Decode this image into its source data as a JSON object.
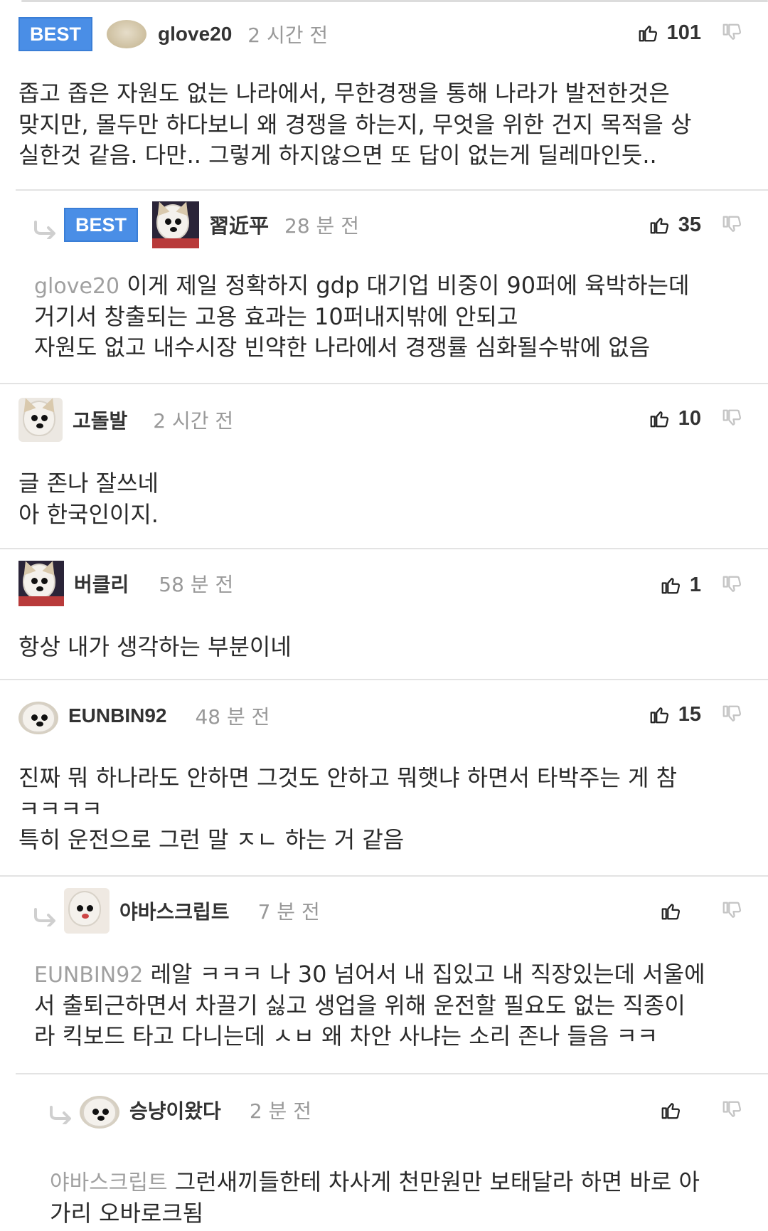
{
  "comments": [
    {
      "best": "BEST",
      "username": "glove20",
      "time": "2 시간 전",
      "likes": "101",
      "mention": "",
      "text": "좁고 좁은 자원도 없는 나라에서, 무한경쟁을 통해 나라가 발전한것은\n맞지만, 몰두만 하다보니 왜 경쟁을 하는지, 무엇을 위한 건지 목적을 상\n실한것 같음. 다만.. 그렇게 하지않으면 또 답이 없는게 딜레마인듯.."
    },
    {
      "best": "BEST",
      "username": "習近平",
      "time": "28 분 전",
      "likes": "35",
      "mention": "glove20",
      "text": "이게 제일 정확하지 gdp 대기업 비중이 90퍼에 육박하는데\n거기서 창출되는 고용 효과는 10퍼내지밖에 안되고\n자원도 없고 내수시장 빈약한 나라에서 경쟁률 심화될수밖에 없음"
    },
    {
      "username": "고돌발",
      "time": "2 시간 전",
      "likes": "10",
      "mention": "",
      "text": "글 존나 잘쓰네\n아 한국인이지."
    },
    {
      "username": "버클리",
      "time": "58 분 전",
      "likes": "1",
      "mention": "",
      "text": "항상 내가 생각하는 부분이네"
    },
    {
      "username": "EUNBIN92",
      "time": "48 분 전",
      "likes": "15",
      "mention": "",
      "text": "진짜 뭐 하나라도 안하면 그것도 안하고 뭐햇냐 하면서 타박주는 게 참\nㅋㅋㅋㅋ\n특히 운전으로 그런 말 ㅈㄴ 하는 거 같음"
    },
    {
      "username": "야바스크립트",
      "time": "7 분 전",
      "likes": "",
      "mention": "EUNBIN92",
      "text": "레알 ㅋㅋㅋ 나 30 넘어서 내 집있고 내 직장있는데 서울에\n서 출퇴근하면서 차끌기 싫고 생업을 위해 운전할 필요도 없는 직종이\n라 킥보드 타고 다니는데 ㅅㅂ 왜 차안 사냐는 소리 존나 들음 ㅋㅋ"
    },
    {
      "username": "승냥이왔다",
      "time": "2 분 전",
      "likes": "",
      "mention": "야바스크립트",
      "text": "그런새끼들한테 차사게 천만원만 보태달라 하면 바로 아\n가리 오바로크됨"
    }
  ],
  "icons": {
    "like": "thumbs-up-icon",
    "dislike": "thumbs-down-icon",
    "reply": "reply-arrow-icon"
  },
  "colors": {
    "best_badge": "#4a8ee6",
    "mention": "#a0a0a0",
    "time": "#999999",
    "divider": "#e3e3e3"
  }
}
